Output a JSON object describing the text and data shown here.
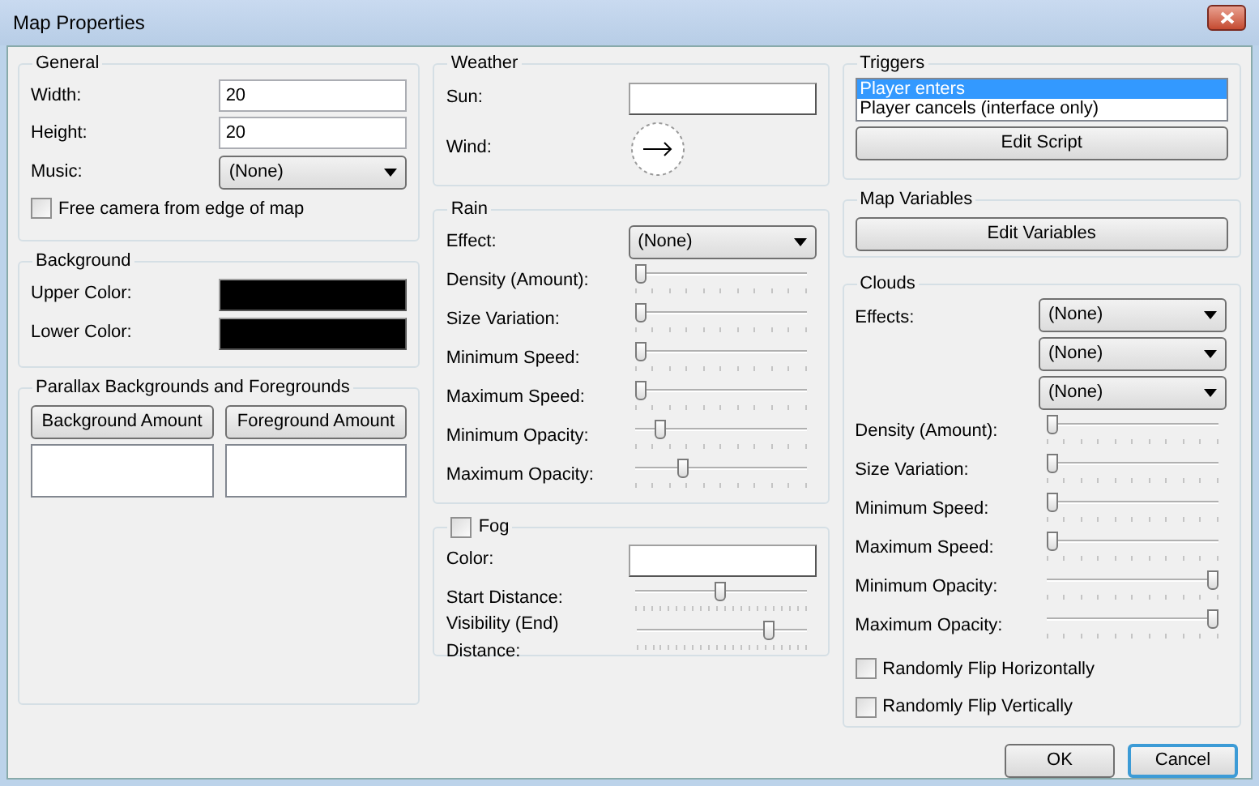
{
  "window": {
    "title": "Map Properties"
  },
  "general": {
    "title": "General",
    "width": {
      "label": "Width:",
      "value": "20"
    },
    "height": {
      "label": "Height:",
      "value": "20"
    },
    "music": {
      "label": "Music:",
      "value": "(None)"
    },
    "free_camera": {
      "label": "Free camera from edge of map",
      "checked": false
    }
  },
  "background": {
    "title": "Background",
    "colors": [
      {
        "label": "Upper Color:",
        "color": "#000000"
      },
      {
        "label": "Lower Color:",
        "color": "#000000"
      }
    ]
  },
  "parallax": {
    "title": "Parallax Backgrounds and Foregrounds",
    "buttons": [
      "Background Amount",
      "Foreground Amount"
    ]
  },
  "weather": {
    "title": "Weather",
    "sun": {
      "label": "Sun:",
      "color": "#ffffff"
    },
    "wind": {
      "label": "Wind:"
    }
  },
  "rain": {
    "title": "Rain",
    "effect": {
      "label": "Effect:",
      "value": "(None)"
    },
    "sliders": [
      {
        "label": "Density (Amount):",
        "level": 0
      },
      {
        "label": "Size Variation:",
        "level": 0
      },
      {
        "label": "Minimum Speed:",
        "level": 0
      },
      {
        "label": "Maximum Speed:",
        "level": 0
      },
      {
        "label": "Minimum Opacity:",
        "level": 0.12
      },
      {
        "label": "Maximum Opacity:",
        "level": 0.27
      }
    ]
  },
  "fog": {
    "title": "Fog",
    "checked": false,
    "color": {
      "label": "Color:",
      "color": "#ffffff"
    },
    "sliders": [
      {
        "label": "Start Distance:",
        "level": 0.5
      },
      {
        "label": "Visibility (End) Distance:",
        "level": 0.8
      }
    ]
  },
  "triggers": {
    "title": "Triggers",
    "items": [
      {
        "label": "Player enters",
        "selected": true
      },
      {
        "label": "Player cancels (interface only)",
        "selected": false
      }
    ],
    "button": "Edit Script"
  },
  "map_variables": {
    "title": "Map Variables",
    "button": "Edit Variables"
  },
  "clouds": {
    "title": "Clouds",
    "effects_label": "Effects:",
    "effects": [
      "(None)",
      "(None)",
      "(None)"
    ],
    "sliders": [
      {
        "label": "Density (Amount):",
        "level": 0
      },
      {
        "label": "Size Variation:",
        "level": 0
      },
      {
        "label": "Minimum Speed:",
        "level": 0
      },
      {
        "label": "Maximum Speed:",
        "level": 0
      },
      {
        "label": "Minimum Opacity:",
        "level": 1
      },
      {
        "label": "Maximum Opacity:",
        "level": 1
      }
    ],
    "checkboxes": [
      {
        "label": "Randomly Flip Horizontally",
        "checked": false
      },
      {
        "label": "Randomly Flip Vertically",
        "checked": false
      }
    ]
  },
  "buttons": [
    {
      "label": "OK",
      "focused": false
    },
    {
      "label": "Cancel",
      "focused": true
    }
  ]
}
